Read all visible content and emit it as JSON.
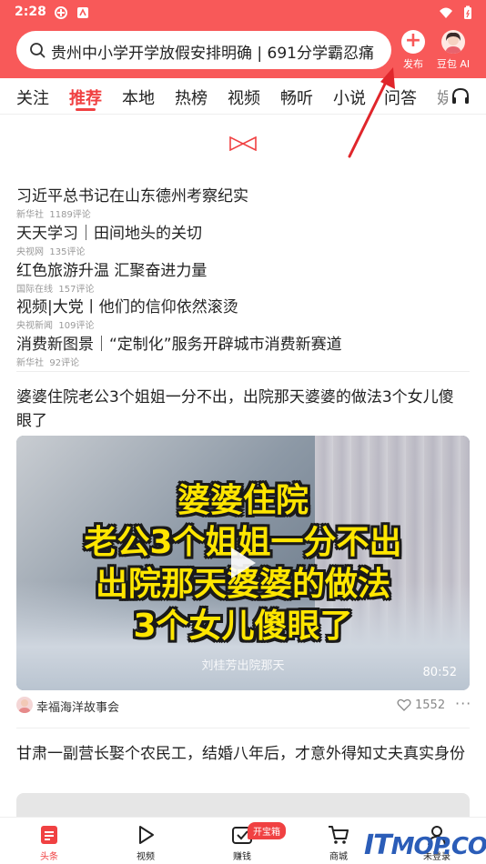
{
  "status_bar": {
    "time": "2:28"
  },
  "search": {
    "placeholder": "贵州中小学开学放假安排明确 | 691分学霸忍痛"
  },
  "header_buttons": {
    "publish_label": "发布",
    "doubao_label": "豆包 AI"
  },
  "tabs": [
    {
      "label": "关注",
      "active": false
    },
    {
      "label": "推荐",
      "active": true
    },
    {
      "label": "本地",
      "active": false
    },
    {
      "label": "热榜",
      "active": false
    },
    {
      "label": "视频",
      "active": false
    },
    {
      "label": "畅听",
      "active": false
    },
    {
      "label": "小说",
      "active": false
    },
    {
      "label": "问答",
      "active": false
    },
    {
      "label": "娱",
      "active": false
    }
  ],
  "headlines": [
    {
      "title": "习近平总书记在山东德州考察纪实",
      "source": "新华社",
      "comments": "1189评论"
    },
    {
      "title": "天天学习｜田间地头的关切",
      "source": "央视网",
      "comments": "135评论"
    },
    {
      "title": "红色旅游升温 汇聚奋进力量",
      "source": "国际在线",
      "comments": "157评论"
    },
    {
      "title": "视频|大党丨他们的信仰依然滚烫",
      "source": "央视新闻",
      "comments": "109评论"
    },
    {
      "title": "消费新图景｜“定制化”服务开辟城市消费新赛道",
      "source": "新华社",
      "comments": "92评论"
    }
  ],
  "article1": {
    "title": "婆婆住院老公3个姐姐一分不出，出院那天婆婆的做法3个女儿傻眼了",
    "caption_lines": [
      "婆婆住院",
      "老公3个姐姐一分不出",
      "出院那天婆婆的做法",
      "3个女儿傻眼了"
    ],
    "subtitle": "刘桂芳出院那天",
    "duration": "80:52",
    "author": "幸福海洋故事会",
    "likes": "1552"
  },
  "article2": {
    "title": "甘肃一副营长娶个农民工，结婚八年后，才意外得知丈夫真实身份"
  },
  "bottom_nav": [
    {
      "label": "头条",
      "icon": "home-icon",
      "active": true
    },
    {
      "label": "视频",
      "icon": "video-icon",
      "active": false
    },
    {
      "label": "赚钱",
      "icon": "earn-icon",
      "active": false
    },
    {
      "label": "商城",
      "icon": "mall-icon",
      "active": false
    },
    {
      "label": "未登录",
      "icon": "user-icon",
      "active": false
    }
  ],
  "treasure_badge": "开宝箱",
  "watermark": {
    "text_big": "IT",
    "text_rest": "MOP.COM"
  },
  "colors": {
    "brand_red": "#f85959",
    "active_red": "#f04142",
    "annotation_red": "#e0262b",
    "caption_yellow": "#ffe600"
  }
}
